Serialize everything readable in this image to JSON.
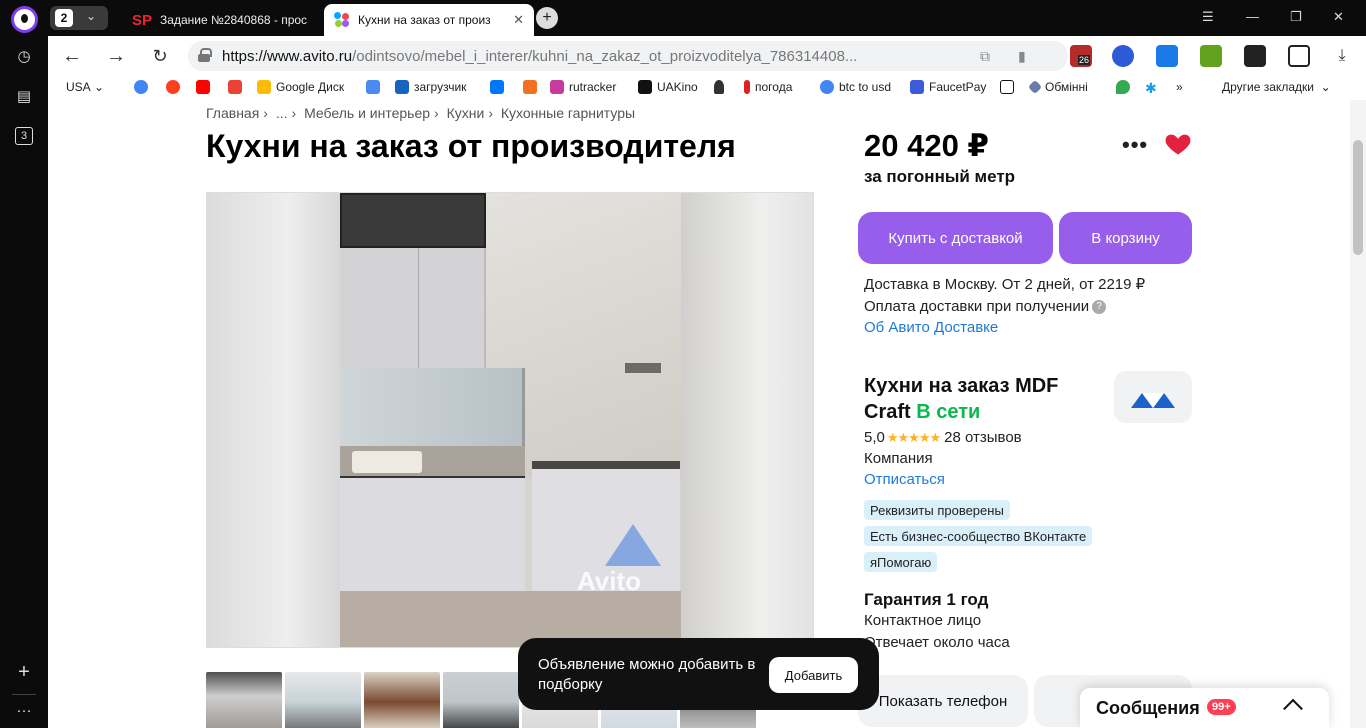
{
  "browser": {
    "tab_count": "2",
    "tabs": [
      {
        "label": "Задание №2840868 - прос",
        "icon": "SP"
      },
      {
        "label": "Кухни на заказ от произ"
      }
    ],
    "url_host": "https://www.avito.ru",
    "url_path": "/odintsovo/mebel_i_interer/kuhni_na_zakaz_ot_proizvoditelya_786314408...",
    "sidebar_badge": "3",
    "bookmarks": [
      "USA",
      "Google Диск",
      "загрузчик",
      "rutracker",
      "UAKino",
      "погода",
      "btc to usd",
      "FaucetPay",
      "Обмінні"
    ],
    "bookmarks_other": "Другие закладки",
    "extension_badge": "26"
  },
  "page": {
    "breadcrumbs": [
      "Главная",
      "...",
      "Мебель и интерьер",
      "Кухни",
      "Кухонные гарнитуры"
    ],
    "title": "Кухни на заказ от производителя",
    "watermark": "Avito",
    "price": "20 420 ₽",
    "price_unit": "за погонный метр",
    "buy_delivery_label": "Купить с доставкой",
    "to_cart_label": "В корзину",
    "delivery_line": "Доставка в Москву. От 2 дней, от 2219 ₽",
    "payment_line": "Оплата доставки при получении",
    "delivery_link": "Об Авито Доставке",
    "seller_name": "Кухни на заказ MDF Craft",
    "seller_status": "В сети",
    "rating_value": "5,0",
    "rating_stars": "★★★★★",
    "reviews": "28 отзывов",
    "seller_type": "Компания",
    "unsubscribe": "Отписаться",
    "badges": [
      "Реквизиты проверены",
      "Есть бизнес-сообщество ВКонтакте",
      "яПомогаю"
    ],
    "guarantee": "Гарантия 1 год",
    "contact_person": "Контактное лицо",
    "response_time": "Отвечает около часа",
    "show_phone_label": "Показать телефон",
    "toast_text": "Объявление можно добавить в подборку",
    "toast_button": "Добавить",
    "messages_label": "Сообщения",
    "messages_count": "99+",
    "accent_color": "#965eeb",
    "online_color": "#0ab84e",
    "link_color": "#1f7ad6"
  }
}
